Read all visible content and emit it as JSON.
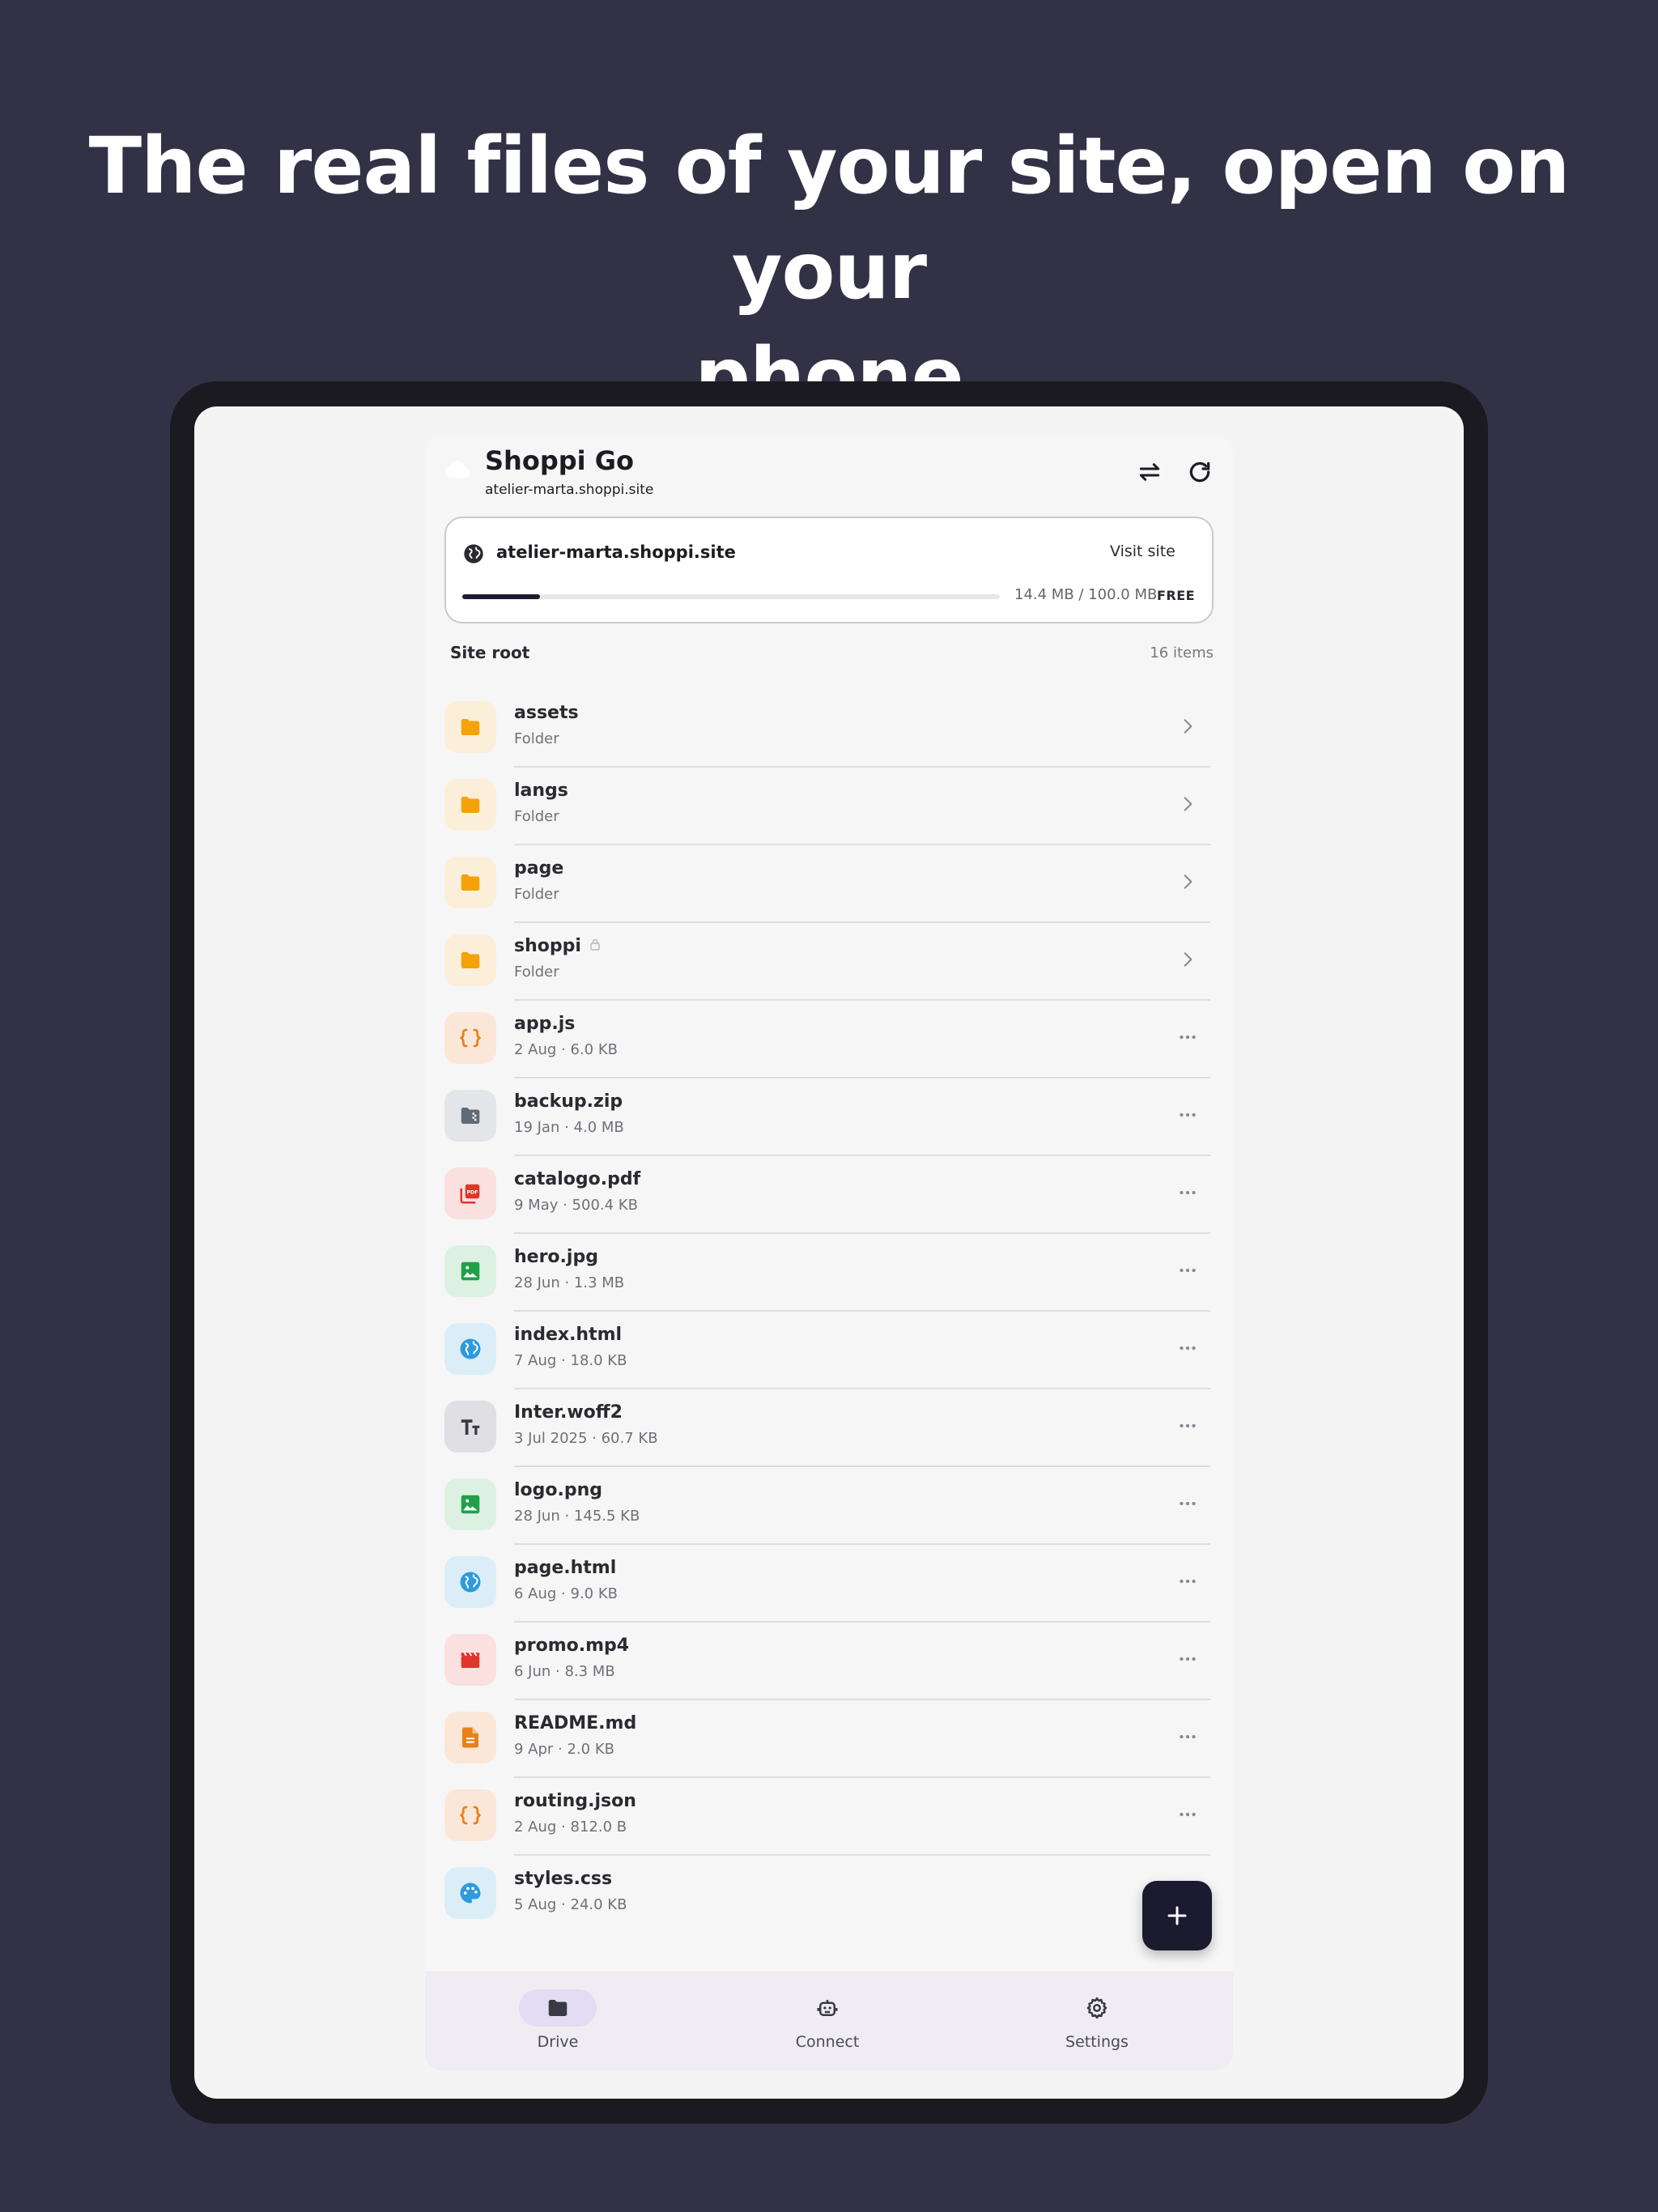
{
  "headline": {
    "line1": "The real files of your site, open on your",
    "line2": "phone"
  },
  "app": {
    "title": "Shoppi Go",
    "subtitle": "atelier-marta.shoppi.site",
    "actions": [
      "swap-icon",
      "refresh-icon"
    ]
  },
  "site_card": {
    "domain": "atelier-marta.shoppi.site",
    "visit_label": "Visit site",
    "usage_text": "14.4 MB / 100.0 MB",
    "usage_fraction": 0.144,
    "plan": "FREE"
  },
  "listing": {
    "section": "Site root",
    "count": "16 items"
  },
  "files": [
    {
      "name": "assets",
      "meta": "Folder",
      "icon": "folder-icon",
      "kind": "folder",
      "color": "#f5a20a",
      "bg": "#fcefd9"
    },
    {
      "name": "langs",
      "meta": "Folder",
      "icon": "folder-icon",
      "kind": "folder",
      "color": "#f5a20a",
      "bg": "#fcefd9"
    },
    {
      "name": "page",
      "meta": "Folder",
      "icon": "folder-icon",
      "kind": "folder",
      "color": "#f5a20a",
      "bg": "#fcefd9"
    },
    {
      "name": "shoppi",
      "meta": "Folder",
      "icon": "folder-icon",
      "kind": "folder",
      "locked": true,
      "color": "#f5a20a",
      "bg": "#fcefd9"
    },
    {
      "name": "app.js",
      "meta": "2 Aug · 6.0 KB",
      "icon": "code-braces-icon",
      "kind": "file",
      "color": "#e8801a",
      "bg": "#fbe7d7"
    },
    {
      "name": "backup.zip",
      "meta": "19 Jan · 4.0 MB",
      "icon": "zip-folder-icon",
      "kind": "file",
      "color": "#5f6b76",
      "bg": "#e3e5e8"
    },
    {
      "name": "catalogo.pdf",
      "meta": "9 May · 500.4 KB",
      "icon": "pdf-icon",
      "kind": "file",
      "color": "#e0352b",
      "bg": "#fbe0e0"
    },
    {
      "name": "hero.jpg",
      "meta": "28 Jun · 1.3 MB",
      "icon": "image-icon",
      "kind": "file",
      "color": "#21a04a",
      "bg": "#dcf1e2"
    },
    {
      "name": "index.html",
      "meta": "7 Aug · 18.0 KB",
      "icon": "globe-icon",
      "kind": "file",
      "color": "#2d9bdc",
      "bg": "#dbeef8"
    },
    {
      "name": "Inter.woff2",
      "meta": "3 Jul 2025 · 60.7 KB",
      "icon": "font-icon",
      "kind": "file",
      "color": "#3a3a46",
      "bg": "#dfdfe4"
    },
    {
      "name": "logo.png",
      "meta": "28 Jun · 145.5 KB",
      "icon": "image-icon",
      "kind": "file",
      "color": "#21a04a",
      "bg": "#dcf1e2"
    },
    {
      "name": "page.html",
      "meta": "6 Aug · 9.0 KB",
      "icon": "globe-icon",
      "kind": "file",
      "color": "#2d9bdc",
      "bg": "#dbeef8"
    },
    {
      "name": "promo.mp4",
      "meta": "6 Jun · 8.3 MB",
      "icon": "video-icon",
      "kind": "file",
      "color": "#e0352b",
      "bg": "#fbe0e0"
    },
    {
      "name": "README.md",
      "meta": "9 Apr · 2.0 KB",
      "icon": "document-icon",
      "kind": "file",
      "color": "#e8801a",
      "bg": "#fbe7d7"
    },
    {
      "name": "routing.json",
      "meta": "2 Aug · 812.0 B",
      "icon": "code-braces-icon",
      "kind": "file",
      "color": "#e8801a",
      "bg": "#fbe7d7"
    },
    {
      "name": "styles.css",
      "meta": "5 Aug · 24.0 KB",
      "icon": "palette-icon",
      "kind": "file",
      "color": "#2d9bdc",
      "bg": "#dbeef8"
    }
  ],
  "nav": [
    {
      "label": "Drive",
      "icon": "folder-icon",
      "active": true
    },
    {
      "label": "Connect",
      "icon": "robot-icon",
      "active": false
    },
    {
      "label": "Settings",
      "icon": "gear-icon",
      "active": false
    }
  ],
  "colors": {
    "background": "#333146",
    "accent": "#1c1a2e",
    "nav_active": "#e2ddf3"
  }
}
